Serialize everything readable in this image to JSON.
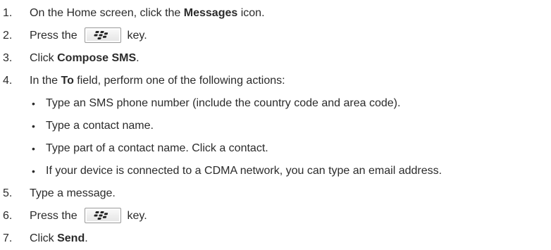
{
  "steps": [
    {
      "num": "1.",
      "pre": "On the Home screen, click the ",
      "bold": "Messages",
      "post": " icon."
    },
    {
      "num": "2.",
      "pre": "Press the ",
      "post": " key."
    },
    {
      "num": "3.",
      "pre": "Click ",
      "bold": "Compose SMS",
      "post": "."
    },
    {
      "num": "4.",
      "pre": "In the ",
      "bold": "To",
      "post": " field, perform one of the following actions:"
    },
    {
      "num": "5.",
      "text": "Type a message."
    },
    {
      "num": "6.",
      "pre": "Press the ",
      "post": " key."
    },
    {
      "num": "7.",
      "pre": "Click ",
      "bold": "Send",
      "post": "."
    }
  ],
  "sub_bullet": "•",
  "sub_items": [
    "Type an SMS phone number (include the country code and area code).",
    "Type a contact name.",
    "Type part of a contact name. Click a contact.",
    "If your device is connected to a CDMA network, you can type an email address."
  ],
  "key_icon": "blackberry-menu-key-icon"
}
